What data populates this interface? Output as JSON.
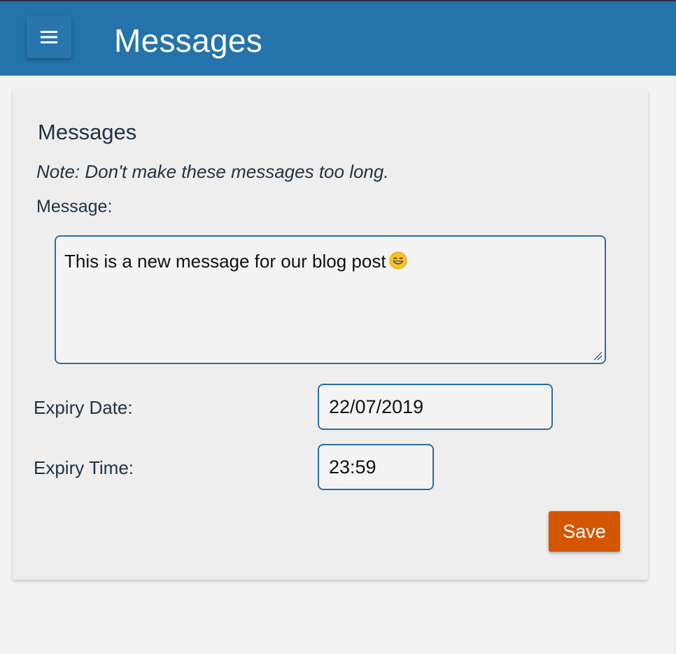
{
  "header": {
    "title": "Messages",
    "menu_icon": "hamburger-menu-icon",
    "background": "#2474ab"
  },
  "card": {
    "title": "Messages",
    "note": "Note: Don't make these messages too long.",
    "message_label": "Message:",
    "message_value": "This is a new message for our blog post",
    "message_emoji": "grinning-face-icon",
    "expiry_date_label": "Expiry Date:",
    "expiry_date_value": "22/07/2019",
    "expiry_time_label": "Expiry Time:",
    "expiry_time_value": "23:59",
    "save_label": "Save",
    "save_color": "#d55600",
    "field_border_color": "#2a6ea5"
  }
}
